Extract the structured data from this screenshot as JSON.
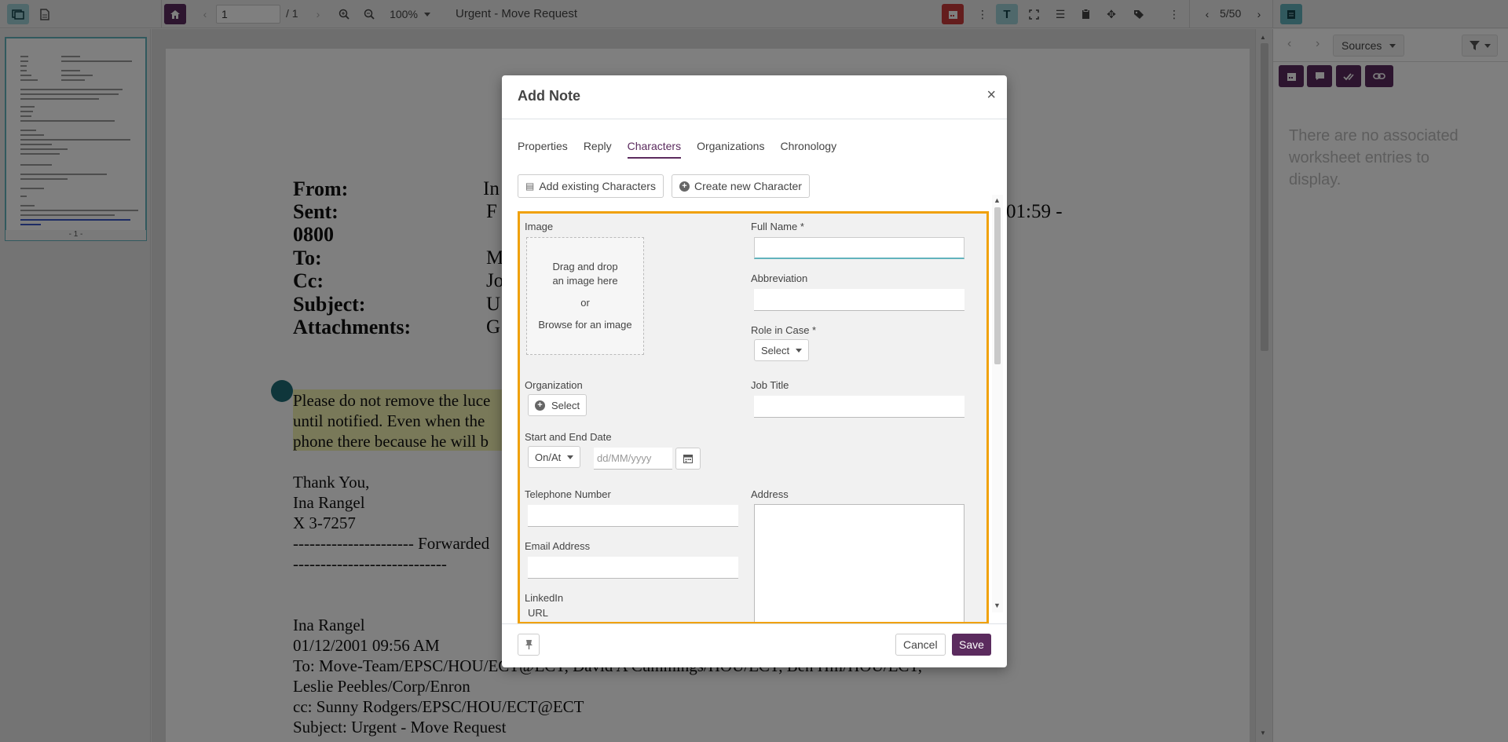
{
  "toolbar": {
    "page_input": "1",
    "page_total": "/ 1",
    "zoom": "100%",
    "doc_title": "Urgent - Move Request",
    "pager": "5/50"
  },
  "thumbnail": {
    "label": "- 1 -"
  },
  "document": {
    "header_labels": [
      "From:",
      "Sent:",
      "0800",
      "To:",
      "Cc:",
      "Subject:",
      "Attachments:"
    ],
    "header_values": [
      "In",
      "F",
      "01:59 -",
      "M",
      "Jo",
      "U",
      "G"
    ],
    "highlight_lines": [
      "Please do not remove the luce",
      "until notified.  Even when the",
      "phone there because he will b"
    ],
    "signoff": [
      "Thank You,",
      "Ina Rangel",
      "X 3-7257"
    ],
    "forwarded": "---------------------- Forwarded",
    "dashes": "----------------------------",
    "lower_lines": [
      "Ina Rangel",
      "01/12/2001 09:56 AM",
      "To: Move-Team/EPSC/HOU/ECT@ECT, David A Cummings/HOU/ECT, Ben Hill/HOU/ECT,",
      "Leslie Peebles/Corp/Enron",
      "cc: Sunny Rodgers/EPSC/HOU/ECT@ECT",
      "Subject: Urgent - Move Request"
    ]
  },
  "right_panel": {
    "sources_label": "Sources",
    "empty_text": "There are no associated worksheet entries to display."
  },
  "modal": {
    "title": "Add Note",
    "close": "×",
    "tabs": [
      "Properties",
      "Reply",
      "Characters",
      "Organizations",
      "Chronology"
    ],
    "add_existing": "Add existing Characters",
    "create_new": "Create new Character",
    "form": {
      "image_label": "Image",
      "dz_line1": "Drag and drop",
      "dz_line2": "an image here",
      "dz_or": "or",
      "dz_browse": "Browse for an image",
      "full_name_label": "Full Name *",
      "abbreviation_label": "Abbreviation",
      "role_label": "Role in Case *",
      "role_select": "Select",
      "organization_label": "Organization",
      "organization_select": "Select",
      "job_title_label": "Job Title",
      "date_label": "Start and End Date",
      "date_mode": "On/At",
      "date_placeholder": "dd/MM/yyyy",
      "telephone_label": "Telephone Number",
      "address_label": "Address",
      "email_label": "Email Address",
      "linkedin_label": "LinkedIn",
      "url_label": "URL"
    },
    "cancel": "Cancel",
    "save": "Save"
  },
  "colors": {
    "accent_purple": "#5b2b5e",
    "accent_teal": "#62b3bd",
    "form_border": "#f0a10a",
    "calendar_red": "#c93a3a"
  }
}
